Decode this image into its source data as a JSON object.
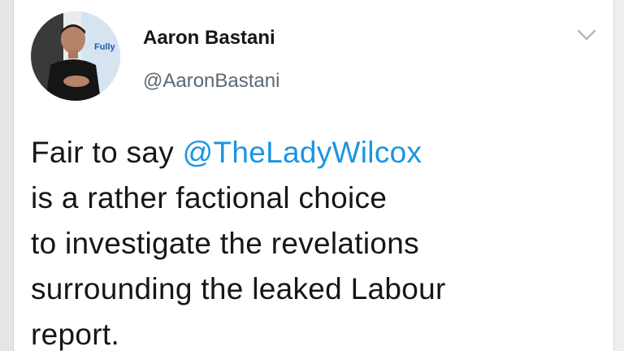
{
  "tweet": {
    "author": {
      "display_name": "Aaron Bastani",
      "handle": "@AaronBastani",
      "avatar_text": "Fully"
    },
    "menu_icon": "chevron-down-icon",
    "body": {
      "line1_prefix": "Fair to say ",
      "mention": "@TheLadyWilcox",
      "line2": "is a rather factional choice",
      "line3": "to investigate the revelations",
      "line4": "surrounding the leaked Labour",
      "line5": "report."
    }
  },
  "colors": {
    "text": "#14171a",
    "secondary": "#5b6873",
    "mention": "#1b95e0"
  }
}
